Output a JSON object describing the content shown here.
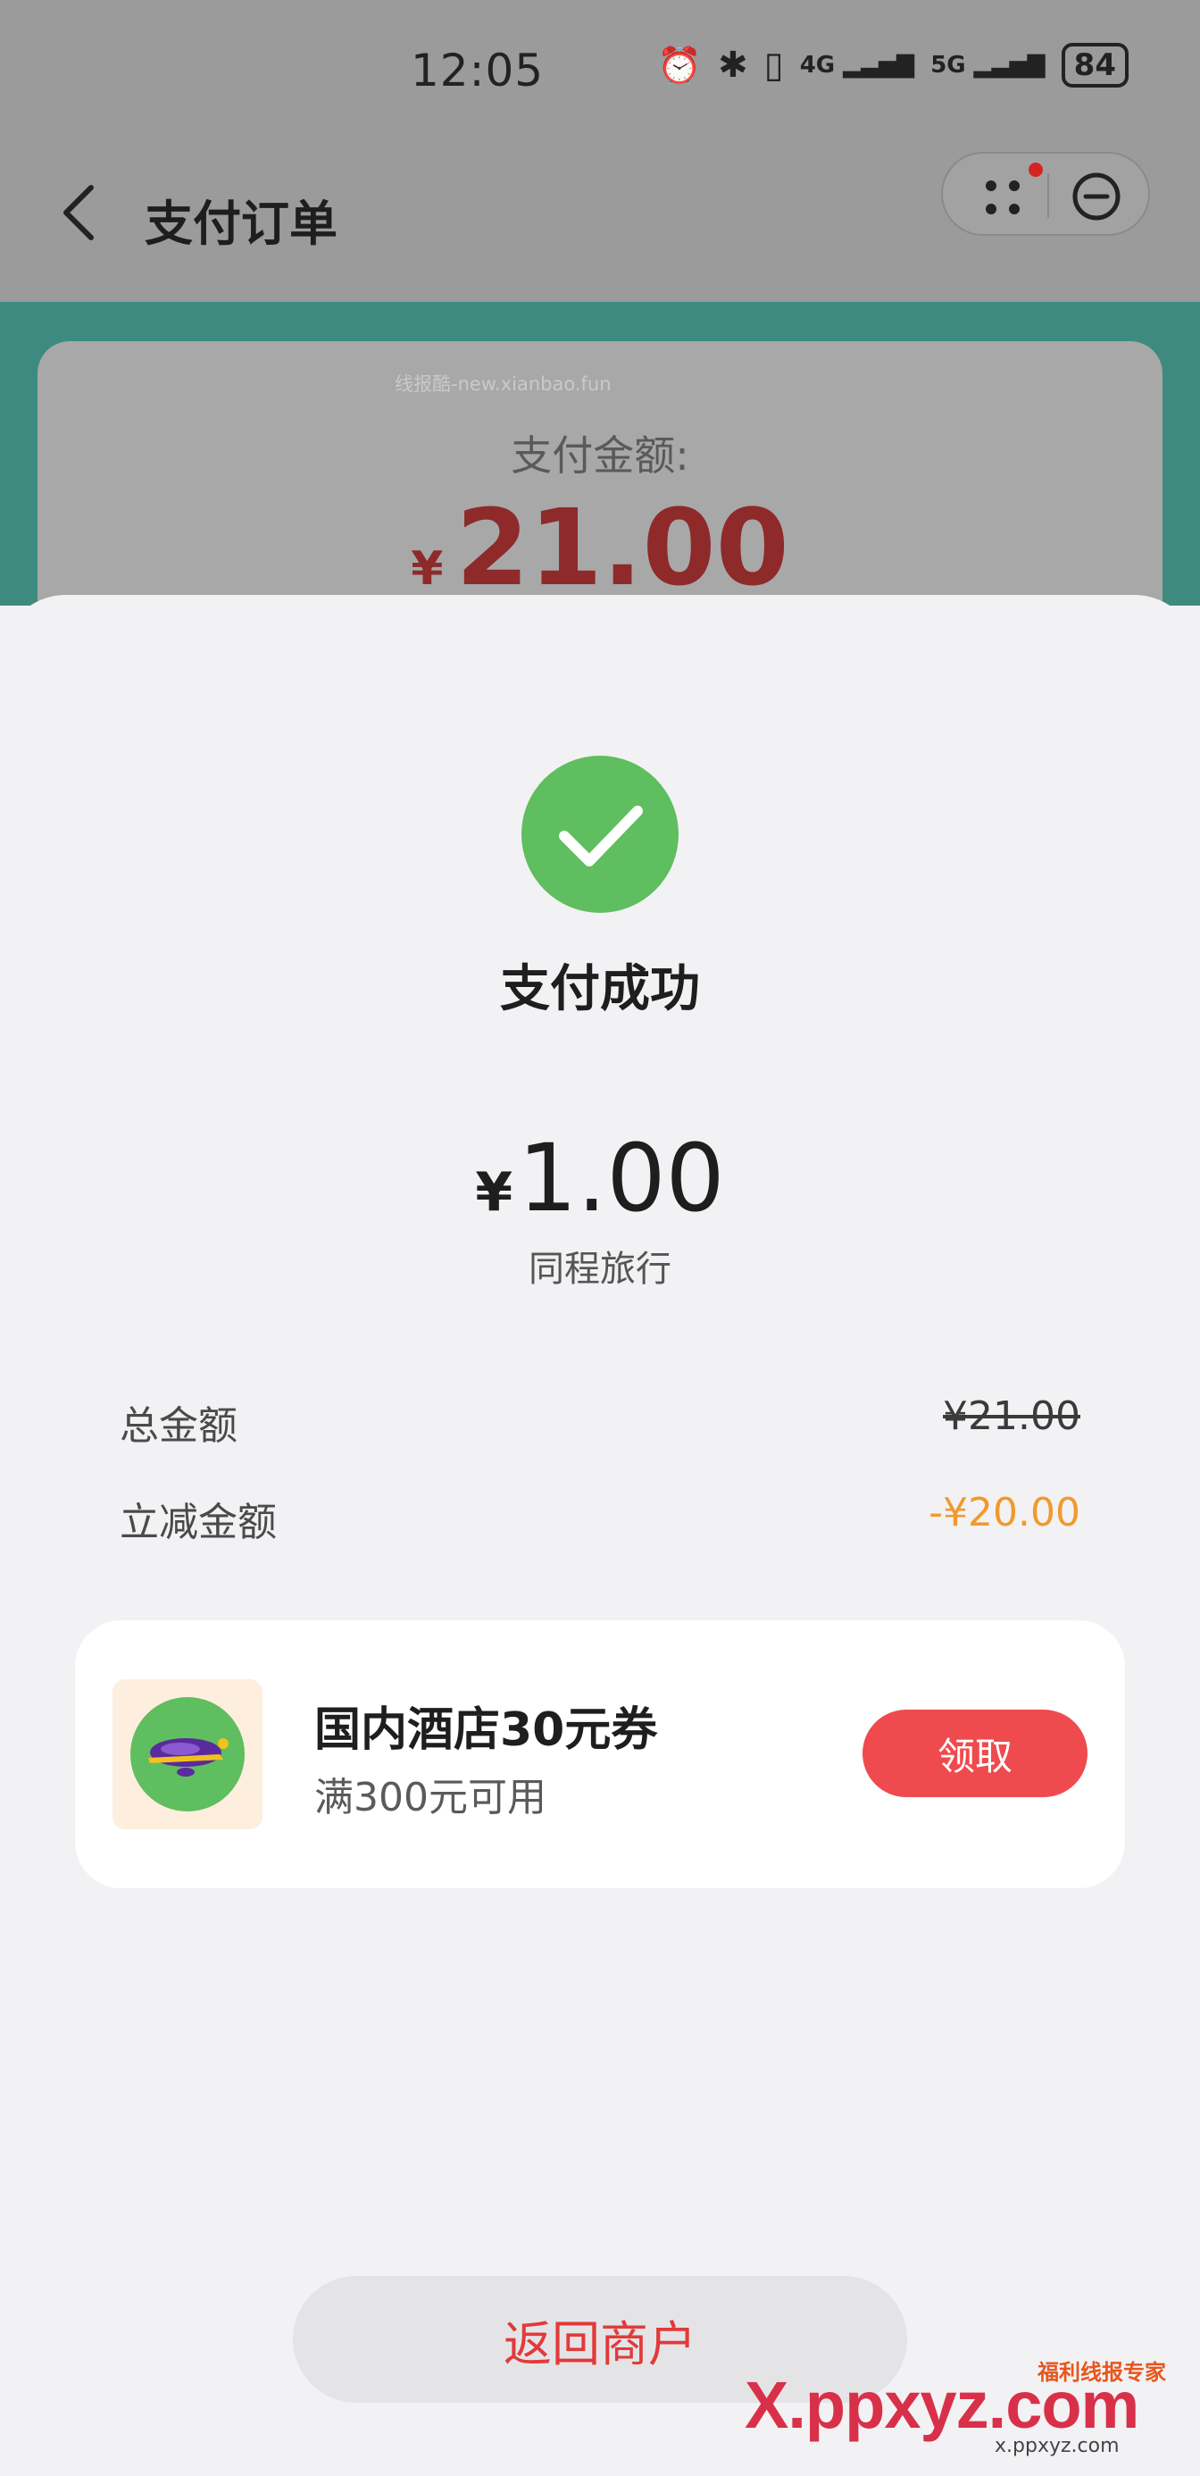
{
  "status_bar": {
    "time": "12:05",
    "signal_4g": "4G",
    "signal_5g": "5G",
    "battery": "84"
  },
  "header": {
    "title": "支付订单"
  },
  "background_card": {
    "watermark": "线报酷-new.xianbao.fun",
    "label": "支付金额:",
    "currency": "¥",
    "amount": "21.00"
  },
  "result": {
    "title": "支付成功",
    "currency": "¥",
    "amount": "1.00",
    "merchant": "同程旅行"
  },
  "summary": {
    "total_label": "总金额",
    "total_value": "¥21.00",
    "discount_label": "立减金额",
    "discount_value": "-¥20.00"
  },
  "coupon": {
    "title": "国内酒店30元券",
    "subtitle": "满300元可用",
    "button": "领取"
  },
  "footer": {
    "return_button": "返回商户"
  },
  "overlay_watermark": {
    "brand": "福利线报专家",
    "logo": "X.ppxyz.com",
    "url": "x.ppxyz.com"
  },
  "colors": {
    "accent_red": "#ef4a4e",
    "discount_orange": "#f09a2c",
    "success_green": "#5fbe5f",
    "teal": "#3f8a7f"
  }
}
